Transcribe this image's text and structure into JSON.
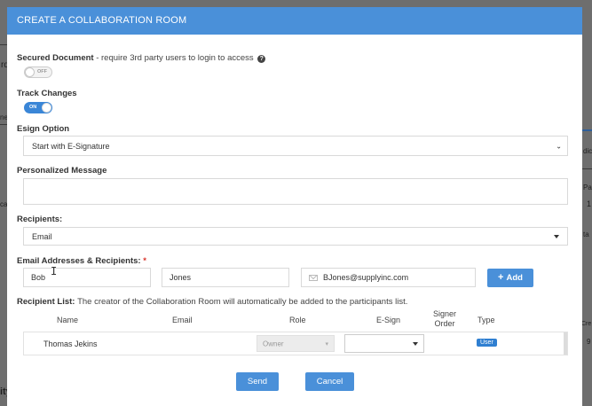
{
  "background": {
    "fragments": [
      "rd",
      "ne",
      "ca",
      "ity",
      "dic",
      "Pa",
      "1",
      "ta",
      "Cre",
      "9"
    ]
  },
  "modal": {
    "title": "CREATE A COLLABORATION ROOM",
    "header_color": "#4a90d9",
    "secured": {
      "label": "Secured Document",
      "description": "- require 3rd party users to login to access",
      "toggle_text": "OFF"
    },
    "track_changes": {
      "label": "Track Changes",
      "toggle_text": "ON"
    },
    "esign": {
      "label": "Esign Option",
      "selected": "Start with E-Signature"
    },
    "message": {
      "label": "Personalized Message",
      "value": ""
    },
    "recipients": {
      "label": "Recipients:",
      "selected": "Email"
    },
    "email_recipients": {
      "label": "Email Addresses & Recipients:",
      "required_mark": "*",
      "first_name": "Bob",
      "last_name": "Jones",
      "email": "BJones@supplyinc.com",
      "add_label": "Add",
      "add_plus": "+"
    },
    "recipient_list": {
      "label": "Recipient List:",
      "note": "The creator of the Collaboration Room will automatically be added to the participants list.",
      "columns": {
        "name": "Name",
        "email": "Email",
        "role": "Role",
        "esign": "E-Sign",
        "signer_order_1": "Signer",
        "signer_order_2": "Order",
        "type": "Type"
      },
      "rows": [
        {
          "name": "Thomas Jekins",
          "email": "",
          "role": "Owner",
          "esign": "",
          "signer_order": "",
          "type": "User"
        }
      ]
    },
    "actions": {
      "send": "Send",
      "cancel": "Cancel"
    }
  }
}
